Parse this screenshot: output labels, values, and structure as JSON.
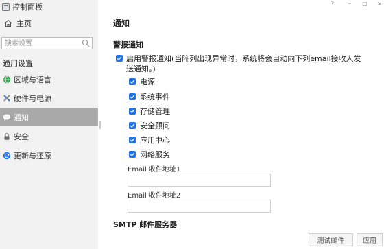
{
  "app": {
    "title": "控制面板",
    "home": "主页"
  },
  "search": {
    "placeholder": "搜索设置"
  },
  "sidebar": {
    "section_title": "通用设置",
    "items": [
      {
        "label": "区域与语言",
        "icon": "globe-icon",
        "active": false
      },
      {
        "label": "硬件与电源",
        "icon": "tools-icon",
        "active": false
      },
      {
        "label": "通知",
        "icon": "chat-bubble-icon",
        "active": true
      },
      {
        "label": "安全",
        "icon": "lock-icon",
        "active": false
      },
      {
        "label": "更新与还原",
        "icon": "refresh-icon",
        "active": false
      }
    ]
  },
  "window": {
    "help": "?",
    "minimize": "–",
    "maximize": "□",
    "close": "×"
  },
  "main": {
    "title": "通知",
    "alert_section": "警报通知",
    "enable_alert": "启用警报通知(当阵列出现异常时，系统将会自动向下列email接收人发送通知。)",
    "categories": [
      "电源",
      "系统事件",
      "存储管理",
      "安全顾问",
      "应用中心",
      "网络服务"
    ],
    "email1_label": "Email 收件地址1",
    "email1_value": "",
    "email2_label": "Email 收件地址2",
    "email2_value": "",
    "smtp_section": "SMTP 邮件服务器",
    "test_button": "测试邮件",
    "apply_button": "应用"
  },
  "colors": {
    "accent": "#1e73e8",
    "sidebar_bg": "#f2f2f2",
    "active_bg": "#a9a9a9"
  }
}
